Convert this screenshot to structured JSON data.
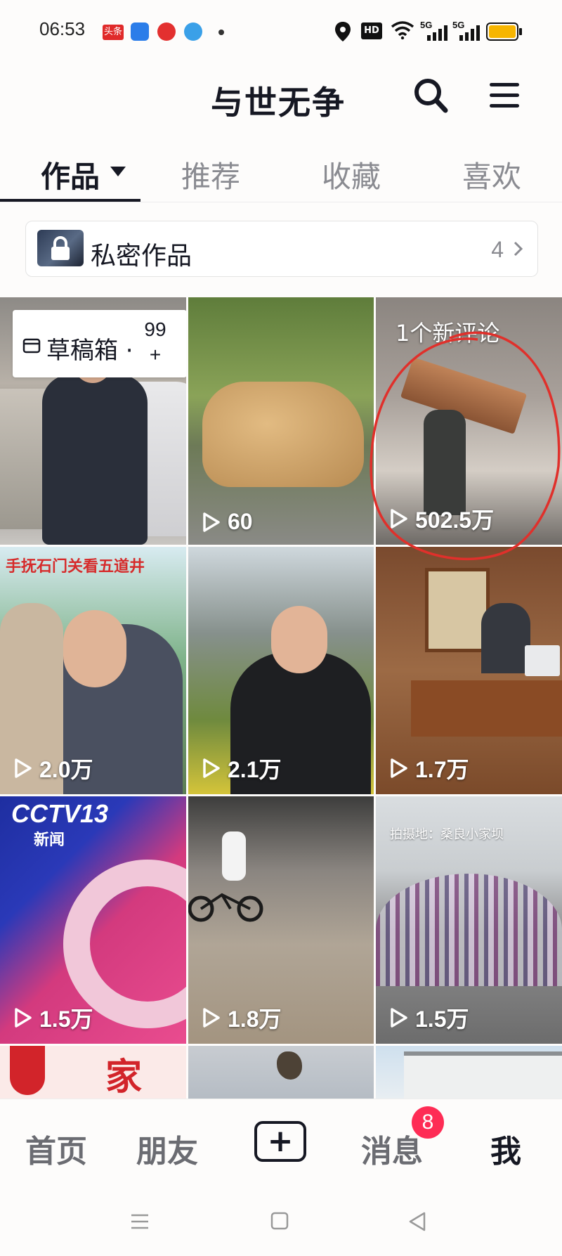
{
  "status_bar": {
    "time": "06:53",
    "icons": [
      "toutiao-icon",
      "app-blue-icon",
      "app-red-icon",
      "app-lightblue-icon",
      "location-icon",
      "hd-icon",
      "wifi-icon",
      "signal-5g-icon",
      "signal-5g-icon",
      "battery-icon"
    ],
    "hd_label": "HD",
    "net1": "5G",
    "net2": "5G",
    "app1_label": "头条"
  },
  "header": {
    "title": "与世无争",
    "search_icon": "search-icon",
    "menu_icon": "menu-icon"
  },
  "tabs": [
    {
      "label": "作品",
      "active": true
    },
    {
      "label": "推荐",
      "active": false
    },
    {
      "label": "收藏",
      "active": false
    },
    {
      "label": "喜欢",
      "active": false
    }
  ],
  "private_works": {
    "label": "私密作品",
    "count": "4"
  },
  "drafts": {
    "label": "草稿箱 ·",
    "count_line1": "99",
    "count_line2": "+"
  },
  "grid": [
    {
      "views": ""
    },
    {
      "views": "60"
    },
    {
      "views": "502.5万",
      "overlay": "1个新评论"
    },
    {
      "views": "2.0万",
      "caption": "手抚石门关看五道井"
    },
    {
      "views": "2.1万"
    },
    {
      "views": "1.7万"
    },
    {
      "views": "1.5万",
      "caption": "CCTV13",
      "caption2": "新闻"
    },
    {
      "views": "1.8万"
    },
    {
      "views": "1.5万",
      "caption": "拍摄地：桑良小家坝"
    },
    {
      "views": "",
      "caption": "家"
    },
    {
      "views": ""
    },
    {
      "views": ""
    }
  ],
  "bottom_nav": {
    "home": "首页",
    "friends": "朋友",
    "plus": "+",
    "messages": "消息",
    "messages_badge": "8",
    "me": "我"
  },
  "colors": {
    "accent": "#fe2c55",
    "text": "#161823",
    "muted": "#8a8b91",
    "annotation": "#e0302b"
  }
}
